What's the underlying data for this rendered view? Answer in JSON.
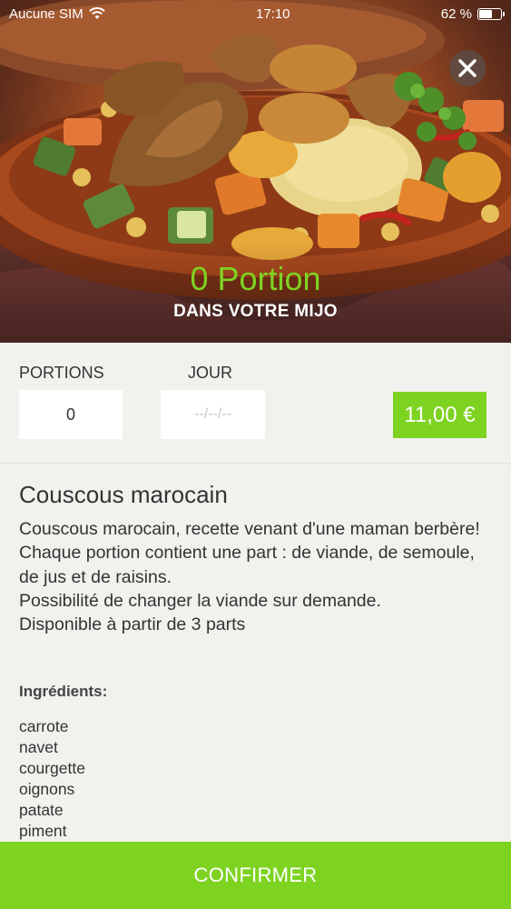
{
  "status_bar": {
    "carrier": "Aucune SIM",
    "time": "17:10",
    "battery_percent": "62 %",
    "battery_level": 0.62
  },
  "hero": {
    "portion_count": "0 Portion",
    "subtitle": "DANS VOTRE MIJO",
    "close_icon": "close-icon"
  },
  "options": {
    "portions_label": "PORTIONS",
    "portions_value": "0",
    "jour_label": "JOUR",
    "date_placeholder": "--/--/--",
    "price": "11,00 €"
  },
  "dish": {
    "title": "Couscous marocain",
    "description": "Couscous marocain, recette venant d'une maman berbère!\nChaque portion contient une part : de viande, de semoule, de jus et de raisins.\nPossibilité de changer la viande sur demande.\nDisponible à partir de  3 parts"
  },
  "ingredients": {
    "title": "Ingrédients:",
    "items": [
      "carrote",
      "navet",
      "courgette",
      "oignons",
      "patate",
      "piment"
    ]
  },
  "confirm_label": "CONFIRMER",
  "colors": {
    "accent_green": "#7ed321",
    "background": "#f2f1ee"
  }
}
